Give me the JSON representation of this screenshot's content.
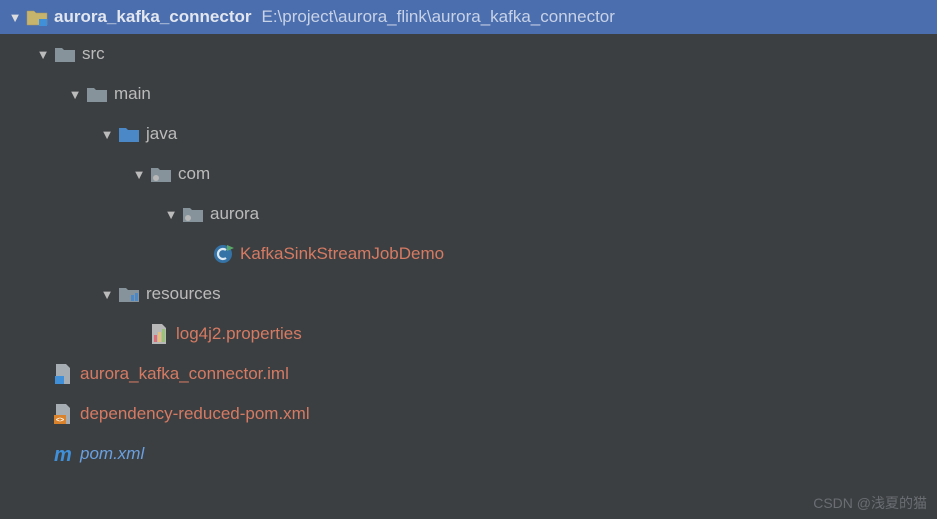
{
  "root": {
    "name": "aurora_kafka_connector",
    "path": "E:\\project\\aurora_flink\\aurora_kafka_connector"
  },
  "nodes": {
    "src": "src",
    "main": "main",
    "java": "java",
    "com": "com",
    "aurora": "aurora",
    "class_demo": "KafkaSinkStreamJobDemo",
    "resources": "resources",
    "log4j2": "log4j2.properties",
    "iml": "aurora_kafka_connector.iml",
    "dep_pom": "dependency-reduced-pom.xml",
    "pom": "pom.xml"
  },
  "watermark": "CSDN @浅夏的猫"
}
